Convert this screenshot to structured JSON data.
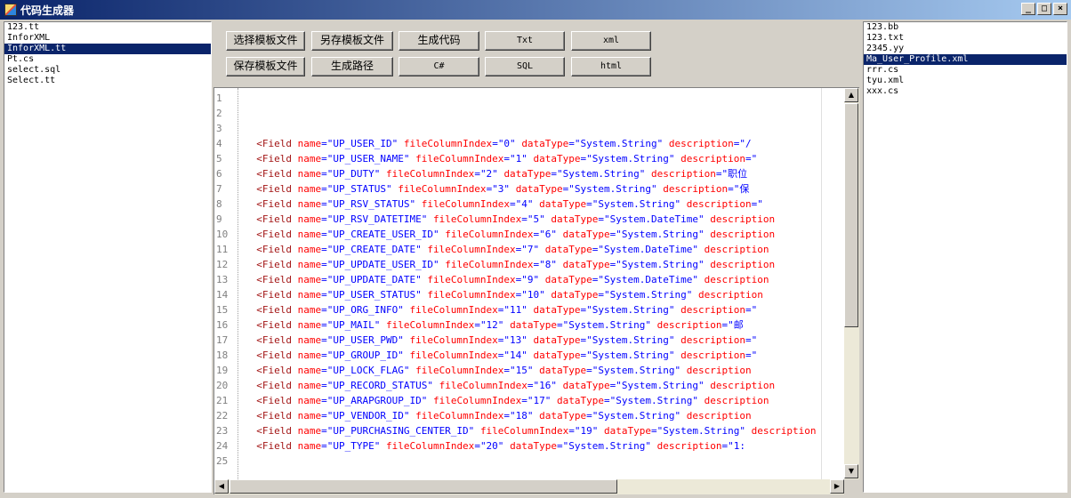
{
  "window": {
    "title": "代码生成器",
    "controls": {
      "minimize": "_",
      "maximize": "□",
      "close": "×"
    }
  },
  "left_files": [
    "123.tt",
    "InforXML",
    "InforXML.tt",
    "Pt.cs",
    "select.sql",
    "Select.tt"
  ],
  "left_selected_index": 2,
  "right_files": [
    "123.bb",
    "123.txt",
    "2345.yy",
    "Ma_User_Profile.xml",
    "rrr.cs",
    "tyu.xml",
    "xxx.cs"
  ],
  "right_selected_index": 3,
  "buttons": {
    "select_template": "选择模板文件",
    "save_as_template": "另存模板文件",
    "generate_code": "生成代码",
    "txt": "Txt",
    "xml": "xml",
    "save_template": "保存模板文件",
    "generate_path": "生成路径",
    "csharp": "C#",
    "sql": "SQL",
    "html": "html"
  },
  "editor": {
    "line_numbers": [
      "1",
      "2",
      "3",
      "4",
      "5",
      "6",
      "7",
      "8",
      "9",
      "10",
      "11",
      "12",
      "13",
      "14",
      "15",
      "16",
      "17",
      "18",
      "19",
      "20",
      "21",
      "22",
      "23",
      "24",
      "25"
    ],
    "lines": [
      null,
      null,
      null,
      {
        "name": "\"UP_USER_ID\"",
        "idx": "\"0\"",
        "type": "\"System.String\"",
        "tail": "\"/"
      },
      {
        "name": "\"UP_USER_NAME\"",
        "idx": "\"1\"",
        "type": "\"System.String\"",
        "tail": "\""
      },
      {
        "name": "\"UP_DUTY\"",
        "idx": "\"2\"",
        "type": "\"System.String\"",
        "tail": "\"职位"
      },
      {
        "name": "\"UP_STATUS\"",
        "idx": "\"3\"",
        "type": "\"System.String\"",
        "tail": "\"保"
      },
      {
        "name": "\"UP_RSV_STATUS\"",
        "idx": "\"4\"",
        "type": "\"System.String\"",
        "tail": "\""
      },
      {
        "name": "\"UP_RSV_DATETIME\"",
        "idx": "\"5\"",
        "type": "\"System.DateTime\"",
        "tail": ""
      },
      {
        "name": "\"UP_CREATE_USER_ID\"",
        "idx": "\"6\"",
        "type": "\"System.String\"",
        "tail": ""
      },
      {
        "name": "\"UP_CREATE_DATE\"",
        "idx": "\"7\"",
        "type": "\"System.DateTime\"",
        "tail": ""
      },
      {
        "name": "\"UP_UPDATE_USER_ID\"",
        "idx": "\"8\"",
        "type": "\"System.String\"",
        "tail": ""
      },
      {
        "name": "\"UP_UPDATE_DATE\"",
        "idx": "\"9\"",
        "type": "\"System.DateTime\"",
        "tail": ""
      },
      {
        "name": "\"UP_USER_STATUS\"",
        "idx": "\"10\"",
        "type": "\"System.String\"",
        "tail": ""
      },
      {
        "name": "\"UP_ORG_INFO\"",
        "idx": "\"11\"",
        "type": "\"System.String\"",
        "tail": "\""
      },
      {
        "name": "\"UP_MAIL\"",
        "idx": "\"12\"",
        "type": "\"System.String\"",
        "tail": "\"邮"
      },
      {
        "name": "\"UP_USER_PWD\"",
        "idx": "\"13\"",
        "type": "\"System.String\"",
        "tail": "\""
      },
      {
        "name": "\"UP_GROUP_ID\"",
        "idx": "\"14\"",
        "type": "\"System.String\"",
        "tail": "\""
      },
      {
        "name": "\"UP_LOCK_FLAG\"",
        "idx": "\"15\"",
        "type": "\"System.String\"",
        "tail": ""
      },
      {
        "name": "\"UP_RECORD_STATUS\"",
        "idx": "\"16\"",
        "type": "\"System.String\"",
        "tail": ""
      },
      {
        "name": "\"UP_ARAPGROUP_ID\"",
        "idx": "\"17\"",
        "type": "\"System.String\"",
        "tail": ""
      },
      {
        "name": "\"UP_VENDOR_ID\"",
        "idx": "\"18\"",
        "type": "\"System.String\"",
        "tail": ""
      },
      {
        "name": "\"UP_PURCHASING_CENTER_ID\"",
        "idx": "\"19\"",
        "type": "\"System.String\"",
        "tail": ""
      },
      {
        "name": "\"UP_TYPE\"",
        "idx": "\"20\"",
        "type": "\"System.String\"",
        "tail": "\"1:"
      },
      null
    ],
    "tokens": {
      "open": "<Field",
      "name_attr": "name",
      "index_attr": "fileColumnIndex",
      "type_attr": "dataType",
      "desc_attr": "description"
    }
  },
  "colors": {
    "title_bar": "#0a246a",
    "selection": "#0a246a",
    "xml_tag": "#a31515",
    "xml_attr": "#ff0000",
    "xml_value": "#0000ff"
  }
}
